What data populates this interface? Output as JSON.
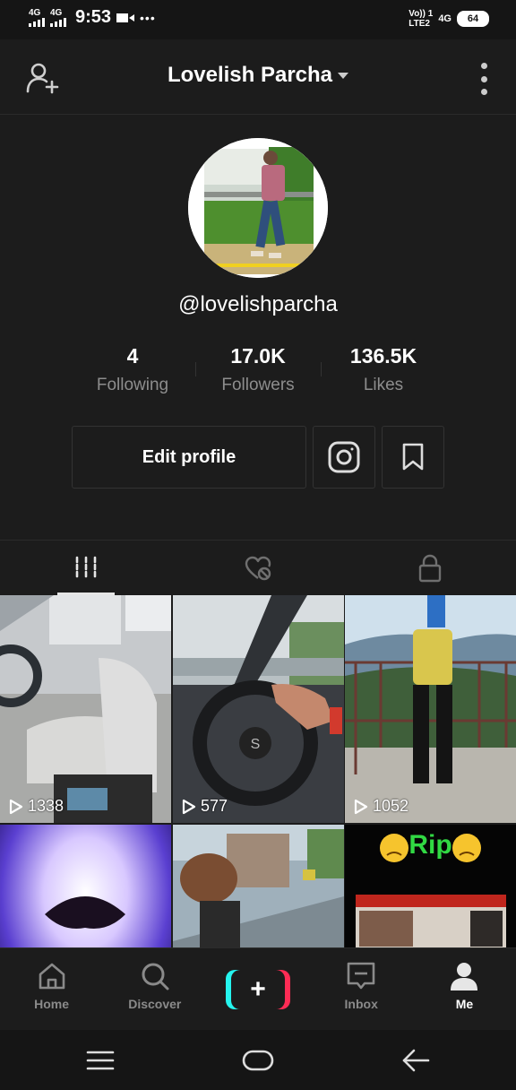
{
  "status_bar": {
    "sim1_label": "4G",
    "sim2_label": "4G",
    "time": "9:53",
    "dots": "•••",
    "volte_line1": "Vo)) 1",
    "volte_line2": "LTE2",
    "network_right": "4G",
    "battery": "64"
  },
  "header": {
    "title": "Lovelish Parcha"
  },
  "profile": {
    "username": "@lovelishparcha",
    "stats": [
      {
        "value": "4",
        "label": "Following"
      },
      {
        "value": "17.0K",
        "label": "Followers"
      },
      {
        "value": "136.5K",
        "label": "Likes"
      }
    ],
    "edit_button": "Edit profile"
  },
  "videos": [
    {
      "plays": "1338"
    },
    {
      "plays": "577"
    },
    {
      "plays": "1052"
    },
    {
      "plays": ""
    },
    {
      "plays": ""
    },
    {
      "plays": ""
    }
  ],
  "tile6_text": "Rip",
  "nav": {
    "items": [
      {
        "label": "Home"
      },
      {
        "label": "Discover"
      },
      {
        "label": "+"
      },
      {
        "label": "Inbox"
      },
      {
        "label": "Me"
      }
    ]
  },
  "colors": {
    "background": "#1c1c1c",
    "accent_cyan": "#25f4ee",
    "accent_red": "#fe2c55"
  }
}
